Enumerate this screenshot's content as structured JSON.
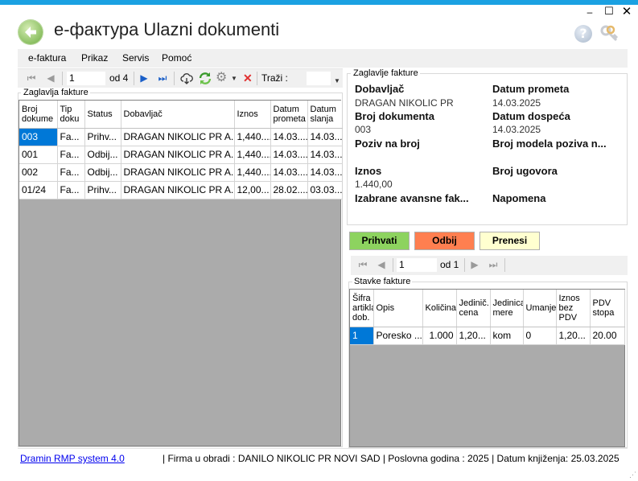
{
  "window": {
    "minimize": "–",
    "maximize": "☐",
    "close": "✕"
  },
  "app_title": "e-фактура Ulazni dokumenti",
  "icons": {
    "back": "back-arrow-icon",
    "help": "help-icon",
    "keys": "keys-icon"
  },
  "menu": [
    "e-faktura",
    "Prikaz",
    "Servis",
    "Pomoć"
  ],
  "left_nav": {
    "page": "1",
    "of": "od 4",
    "search_label": "Traži :"
  },
  "left_group": {
    "legend": "Zaglavlja fakture",
    "columns": [
      "Broj dokume",
      "Tip doku",
      "Status",
      "Dobavljač",
      "Iznos",
      "Datum prometa",
      "Datum slanja"
    ],
    "rows": [
      [
        "003",
        "Fa...",
        "Prihv...",
        "DRAGAN NIKOLIC PR A...",
        "1,440....",
        "14.03....",
        "14.03...."
      ],
      [
        "001",
        "Fa...",
        "Odbij...",
        "DRAGAN NIKOLIC PR A...",
        "1,440....",
        "14.03....",
        "14.03...."
      ],
      [
        "002",
        "Fa...",
        "Odbij...",
        "DRAGAN NIKOLIC PR A...",
        "1,440....",
        "14.03....",
        "14.03...."
      ],
      [
        "01/24",
        "Fa...",
        "Prihv...",
        "DRAGAN NIKOLIC PR A...",
        "12,00...",
        "28.02....",
        "03.03...."
      ]
    ]
  },
  "header_panel": {
    "legend": "Zaglavlje fakture",
    "dobavljac_label": "Dobavljač",
    "dobavljac_value": "DRAGAN NIKOLIC PR",
    "datum_prometa_label": "Datum prometa",
    "datum_prometa_value": "14.03.2025",
    "broj_dok_label": "Broj dokumenta",
    "broj_dok_value": "003",
    "datum_dospeca_label": "Datum dospeća",
    "datum_dospeca_value": "14.03.2025",
    "poziv_label": "Poziv na broj",
    "broj_modela_label": "Broj modela poziva n...",
    "iznos_label": "Iznos",
    "iznos_value": "1.440,00",
    "broj_ugovora_label": "Broj ugovora",
    "avans_label": "Izabrane avansne fak...",
    "napomena_label": "Napomena"
  },
  "actions": {
    "accept": "Prihvati",
    "reject": "Odbij",
    "transfer": "Prenesi",
    "accept_color": "#8dd35f",
    "reject_color": "#ff7f50",
    "transfer_color": "#ffffd0"
  },
  "right_nav": {
    "page": "1",
    "of": "od 1"
  },
  "right_group": {
    "legend": "Stavke fakture",
    "columns": [
      "Šifra artikla dob.",
      "Opis",
      "Količina",
      "Jedinič. cena",
      "Jedinica mere",
      "Umanje",
      "Iznos bez PDV",
      "PDV stopa"
    ],
    "rows": [
      [
        "1",
        "Poresko ...",
        "1.000",
        "1,20...",
        "kom",
        "0",
        "1,20...",
        "20.00"
      ]
    ]
  },
  "status": {
    "link": "Dramin RMP system 4.0",
    "text": "|  Firma u obradi : DANILO NIKOLIC PR NOVI SAD  |  Poslovna godina : 2025  |  Datum knjiženja: 25.03.2025"
  }
}
